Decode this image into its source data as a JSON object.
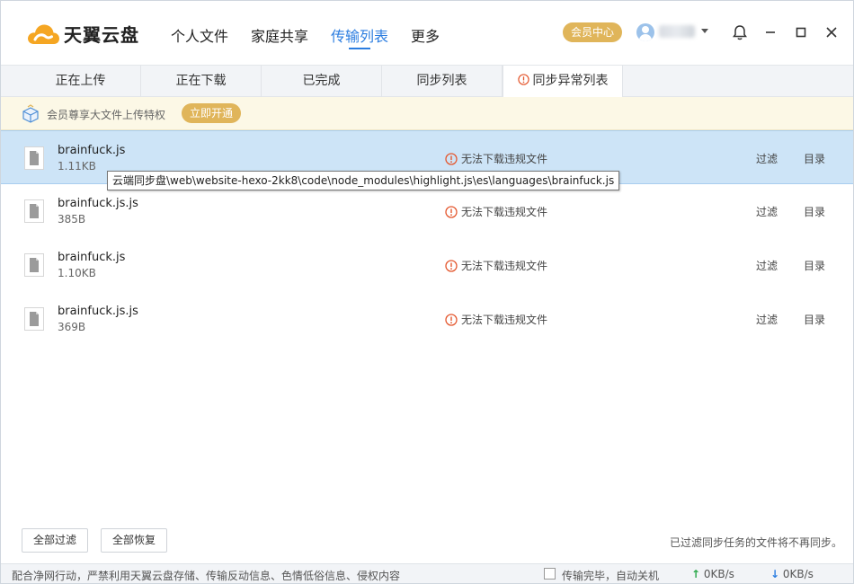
{
  "app": {
    "brand": "天翼云盘",
    "brand_color": "#f5a623",
    "accent_color": "#2b7de0",
    "nav": [
      "个人文件",
      "家庭共享",
      "传输列表",
      "更多"
    ],
    "active_nav": "传输列表",
    "vip_center": "会员中心"
  },
  "tabs": [
    "正在上传",
    "正在下载",
    "已完成",
    "同步列表",
    "同步异常列表"
  ],
  "active_tab": "同步异常列表",
  "promo": {
    "text": "会员尊享大文件上传特权",
    "button": "立即开通"
  },
  "files": [
    {
      "name": "brainfuck.js",
      "size": "1.11KB",
      "status": "无法下载违规文件",
      "filter": "过滤",
      "dir": "目录"
    },
    {
      "name": "brainfuck.js.js",
      "size": "385B",
      "status": "无法下载违规文件",
      "filter": "过滤",
      "dir": "目录"
    },
    {
      "name": "brainfuck.js",
      "size": "1.10KB",
      "status": "无法下载违规文件",
      "filter": "过滤",
      "dir": "目录"
    },
    {
      "name": "brainfuck.js.js",
      "size": "369B",
      "status": "无法下载违规文件",
      "filter": "过滤",
      "dir": "目录"
    }
  ],
  "tooltip": "云端同步盘\\web\\website-hexo-2kk8\\code\\node_modules\\highlight.js\\es\\languages\\brainfuck.js",
  "bottom": {
    "filter_all": "全部过滤",
    "restore_all": "全部恢复",
    "note": "已过滤同步任务的文件将不再同步。"
  },
  "status_bar": {
    "notice": "配合净网行动，严禁利用天翼云盘存储、传输反动信息、色情低俗信息、侵权内容",
    "shutdown_label": "传输完毕，自动关机",
    "upload_speed": "0KB/s",
    "download_speed": "0KB/s"
  }
}
